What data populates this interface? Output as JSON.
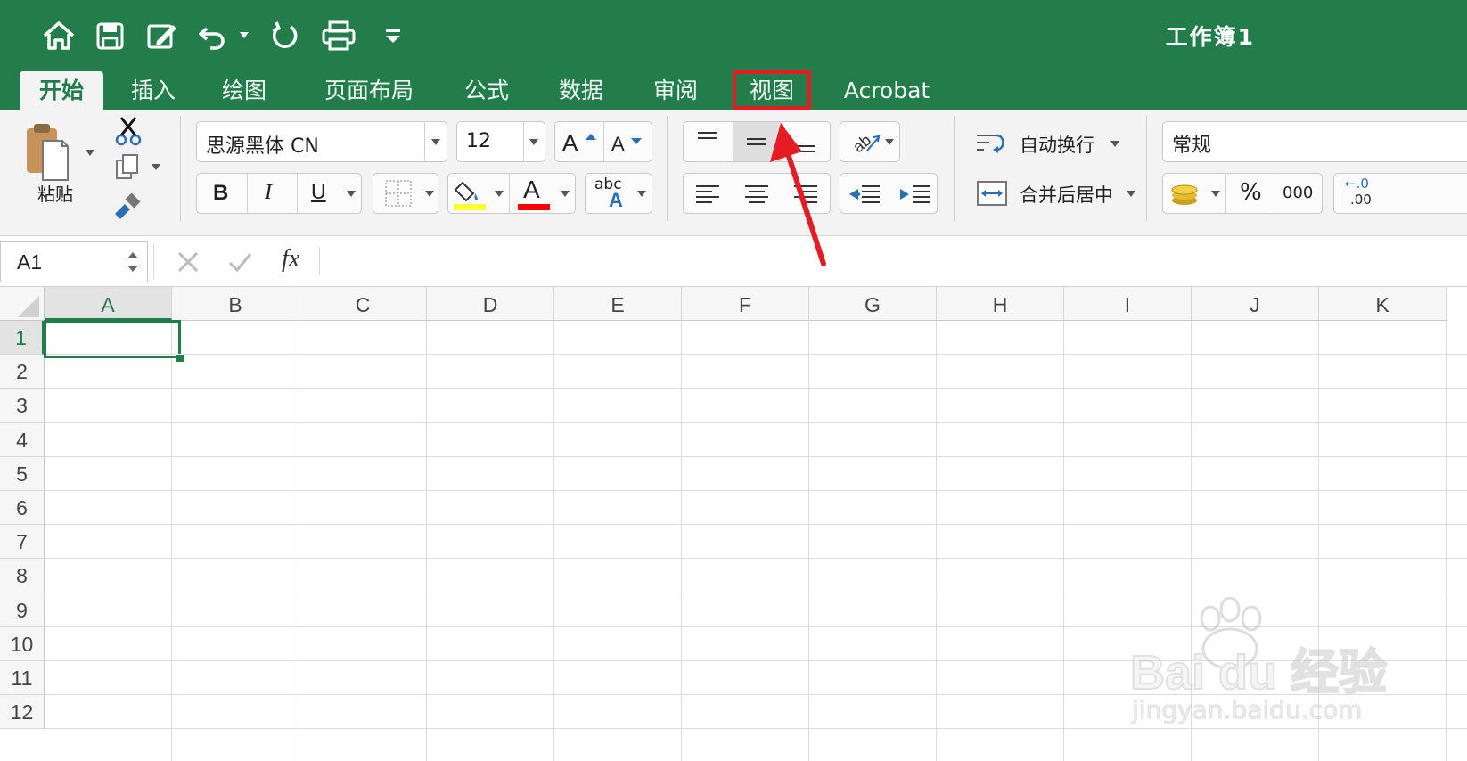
{
  "title_bar": {
    "document_title": "工作簿1"
  },
  "quick_access": {
    "icons": [
      "home-icon",
      "save-icon",
      "edit-icon",
      "undo-icon",
      "redo-icon",
      "print-icon",
      "customize-icon"
    ]
  },
  "tabs": [
    {
      "label": "开始",
      "active": true
    },
    {
      "label": "插入"
    },
    {
      "label": "绘图"
    },
    {
      "label": "页面布局"
    },
    {
      "label": "公式"
    },
    {
      "label": "数据"
    },
    {
      "label": "审阅"
    },
    {
      "label": "视图",
      "highlighted": true
    },
    {
      "label": "Acrobat"
    }
  ],
  "ribbon": {
    "paste_label": "粘贴",
    "font_name": "思源黑体 CN",
    "font_size": "12",
    "bold": "B",
    "italic": "I",
    "underline": "U",
    "font_color_letter": "A",
    "abc_label": "abc",
    "wrap_text_label": "自动换行",
    "merge_center_label": "合并后居中",
    "number_format": "常规",
    "percent": "%",
    "thousands": "000",
    "increase_decimal_top": "←.0",
    "increase_decimal_bottom": ".00",
    "highlight_color": "#ffff33",
    "font_color": "#ff0000"
  },
  "formula_bar": {
    "name_box": "A1",
    "fx_label": "fx",
    "formula_value": ""
  },
  "sheet": {
    "columns": [
      "A",
      "B",
      "C",
      "D",
      "E",
      "F",
      "G",
      "H",
      "I",
      "J",
      "K"
    ],
    "rows": [
      "1",
      "2",
      "3",
      "4",
      "5",
      "6",
      "7",
      "8",
      "9",
      "10",
      "11",
      "12"
    ],
    "selected_cell": "A1"
  },
  "watermark": {
    "brand": "Bai du 经验",
    "url": "jingyan.baidu.com"
  },
  "colors": {
    "title_green": "#237d4a",
    "annotation_red": "#e51c23"
  }
}
